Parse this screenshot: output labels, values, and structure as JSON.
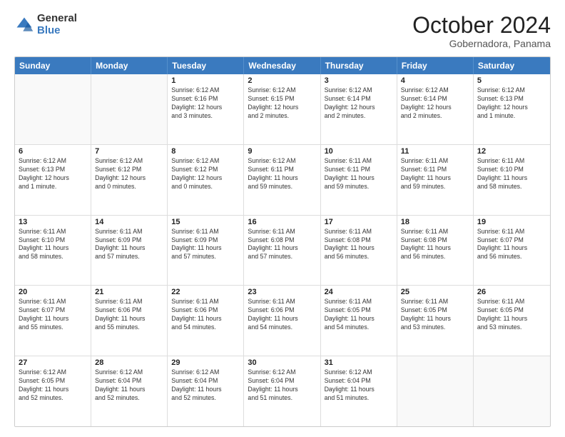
{
  "header": {
    "logo": {
      "general": "General",
      "blue": "Blue"
    },
    "month": "October 2024",
    "location": "Gobernadora, Panama"
  },
  "days_of_week": [
    "Sunday",
    "Monday",
    "Tuesday",
    "Wednesday",
    "Thursday",
    "Friday",
    "Saturday"
  ],
  "weeks": [
    [
      {
        "day": "",
        "info": ""
      },
      {
        "day": "",
        "info": ""
      },
      {
        "day": "1",
        "info": "Sunrise: 6:12 AM\nSunset: 6:16 PM\nDaylight: 12 hours\nand 3 minutes."
      },
      {
        "day": "2",
        "info": "Sunrise: 6:12 AM\nSunset: 6:15 PM\nDaylight: 12 hours\nand 2 minutes."
      },
      {
        "day": "3",
        "info": "Sunrise: 6:12 AM\nSunset: 6:14 PM\nDaylight: 12 hours\nand 2 minutes."
      },
      {
        "day": "4",
        "info": "Sunrise: 6:12 AM\nSunset: 6:14 PM\nDaylight: 12 hours\nand 2 minutes."
      },
      {
        "day": "5",
        "info": "Sunrise: 6:12 AM\nSunset: 6:13 PM\nDaylight: 12 hours\nand 1 minute."
      }
    ],
    [
      {
        "day": "6",
        "info": "Sunrise: 6:12 AM\nSunset: 6:13 PM\nDaylight: 12 hours\nand 1 minute."
      },
      {
        "day": "7",
        "info": "Sunrise: 6:12 AM\nSunset: 6:12 PM\nDaylight: 12 hours\nand 0 minutes."
      },
      {
        "day": "8",
        "info": "Sunrise: 6:12 AM\nSunset: 6:12 PM\nDaylight: 12 hours\nand 0 minutes."
      },
      {
        "day": "9",
        "info": "Sunrise: 6:12 AM\nSunset: 6:11 PM\nDaylight: 11 hours\nand 59 minutes."
      },
      {
        "day": "10",
        "info": "Sunrise: 6:11 AM\nSunset: 6:11 PM\nDaylight: 11 hours\nand 59 minutes."
      },
      {
        "day": "11",
        "info": "Sunrise: 6:11 AM\nSunset: 6:11 PM\nDaylight: 11 hours\nand 59 minutes."
      },
      {
        "day": "12",
        "info": "Sunrise: 6:11 AM\nSunset: 6:10 PM\nDaylight: 11 hours\nand 58 minutes."
      }
    ],
    [
      {
        "day": "13",
        "info": "Sunrise: 6:11 AM\nSunset: 6:10 PM\nDaylight: 11 hours\nand 58 minutes."
      },
      {
        "day": "14",
        "info": "Sunrise: 6:11 AM\nSunset: 6:09 PM\nDaylight: 11 hours\nand 57 minutes."
      },
      {
        "day": "15",
        "info": "Sunrise: 6:11 AM\nSunset: 6:09 PM\nDaylight: 11 hours\nand 57 minutes."
      },
      {
        "day": "16",
        "info": "Sunrise: 6:11 AM\nSunset: 6:08 PM\nDaylight: 11 hours\nand 57 minutes."
      },
      {
        "day": "17",
        "info": "Sunrise: 6:11 AM\nSunset: 6:08 PM\nDaylight: 11 hours\nand 56 minutes."
      },
      {
        "day": "18",
        "info": "Sunrise: 6:11 AM\nSunset: 6:08 PM\nDaylight: 11 hours\nand 56 minutes."
      },
      {
        "day": "19",
        "info": "Sunrise: 6:11 AM\nSunset: 6:07 PM\nDaylight: 11 hours\nand 56 minutes."
      }
    ],
    [
      {
        "day": "20",
        "info": "Sunrise: 6:11 AM\nSunset: 6:07 PM\nDaylight: 11 hours\nand 55 minutes."
      },
      {
        "day": "21",
        "info": "Sunrise: 6:11 AM\nSunset: 6:06 PM\nDaylight: 11 hours\nand 55 minutes."
      },
      {
        "day": "22",
        "info": "Sunrise: 6:11 AM\nSunset: 6:06 PM\nDaylight: 11 hours\nand 54 minutes."
      },
      {
        "day": "23",
        "info": "Sunrise: 6:11 AM\nSunset: 6:06 PM\nDaylight: 11 hours\nand 54 minutes."
      },
      {
        "day": "24",
        "info": "Sunrise: 6:11 AM\nSunset: 6:05 PM\nDaylight: 11 hours\nand 54 minutes."
      },
      {
        "day": "25",
        "info": "Sunrise: 6:11 AM\nSunset: 6:05 PM\nDaylight: 11 hours\nand 53 minutes."
      },
      {
        "day": "26",
        "info": "Sunrise: 6:11 AM\nSunset: 6:05 PM\nDaylight: 11 hours\nand 53 minutes."
      }
    ],
    [
      {
        "day": "27",
        "info": "Sunrise: 6:12 AM\nSunset: 6:05 PM\nDaylight: 11 hours\nand 52 minutes."
      },
      {
        "day": "28",
        "info": "Sunrise: 6:12 AM\nSunset: 6:04 PM\nDaylight: 11 hours\nand 52 minutes."
      },
      {
        "day": "29",
        "info": "Sunrise: 6:12 AM\nSunset: 6:04 PM\nDaylight: 11 hours\nand 52 minutes."
      },
      {
        "day": "30",
        "info": "Sunrise: 6:12 AM\nSunset: 6:04 PM\nDaylight: 11 hours\nand 51 minutes."
      },
      {
        "day": "31",
        "info": "Sunrise: 6:12 AM\nSunset: 6:04 PM\nDaylight: 11 hours\nand 51 minutes."
      },
      {
        "day": "",
        "info": ""
      },
      {
        "day": "",
        "info": ""
      }
    ]
  ]
}
